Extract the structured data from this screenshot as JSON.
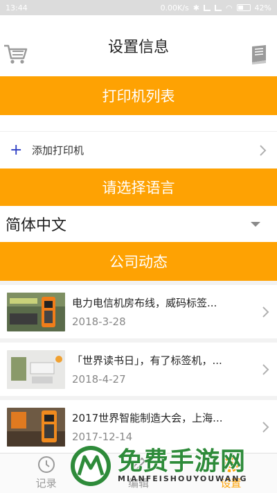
{
  "status_bar": {
    "time": "13:44",
    "speed": "0.00K/s",
    "battery": "42%",
    "battery_level": 0.42
  },
  "header": {
    "title": "设置信息",
    "left_icon": "cart-icon",
    "right_icon": "book-icon"
  },
  "printers": {
    "header": "打印机列表",
    "add_label": "添加打印机"
  },
  "language": {
    "header": "请选择语言",
    "selected": "简体中文"
  },
  "company": {
    "header": "公司动态",
    "items": [
      {
        "title": "电力电信机房布线，威码标签...",
        "date": "2018-3-28"
      },
      {
        "title": "「世界读书日」，有了标签机，...",
        "date": "2018-4-27"
      },
      {
        "title": "2017世界智能制造大会，上海...",
        "date": "2017-12-14"
      }
    ]
  },
  "tabs": [
    {
      "label": "记录",
      "icon": "history-icon",
      "active": false
    },
    {
      "label": "编辑",
      "icon": "edit-icon",
      "active": false
    },
    {
      "label": "设置",
      "icon": "settings-icon",
      "active": true
    }
  ],
  "watermark": {
    "text": "免费手游网",
    "subtext": "MIANFEISHOUYOUWANG"
  },
  "colors": {
    "accent": "#fea203",
    "plus": "#2b3cc4",
    "watermark_green": "#2e8b3a"
  }
}
